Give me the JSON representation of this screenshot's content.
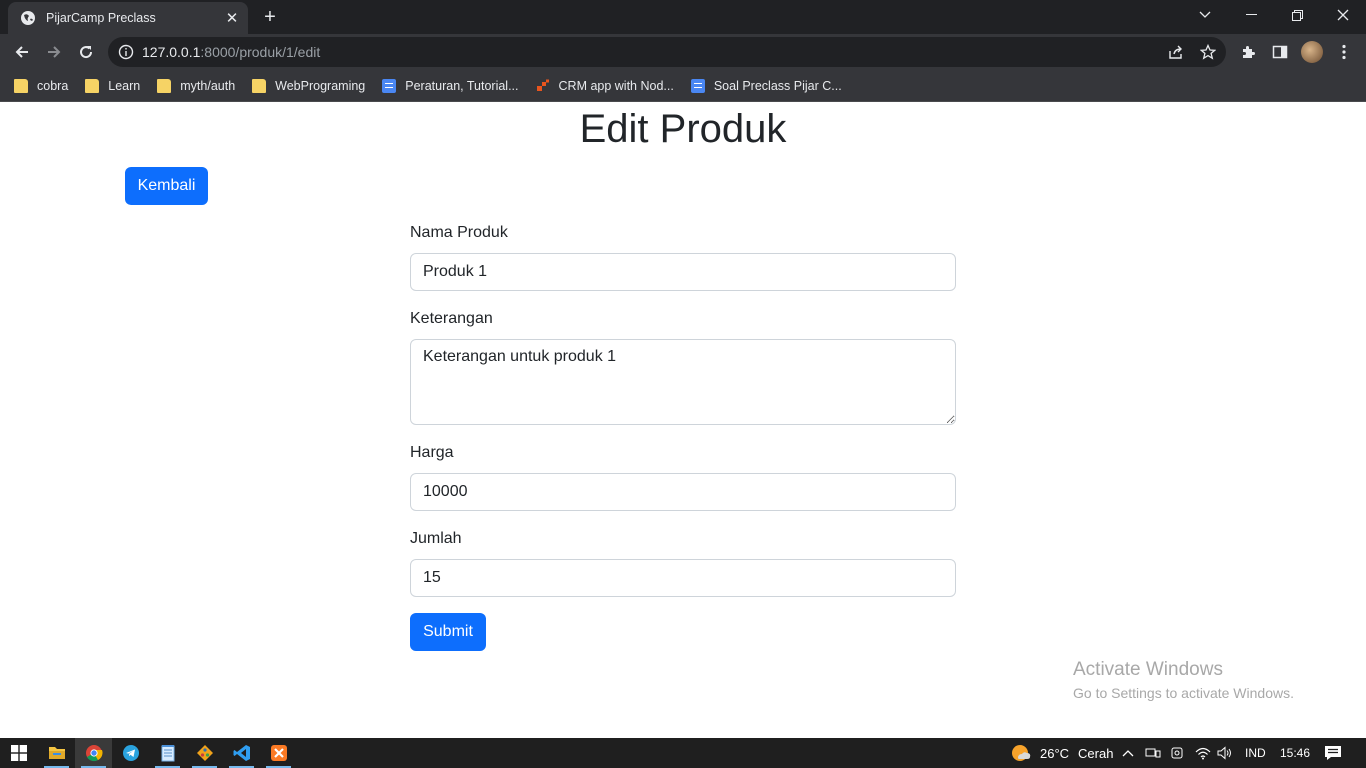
{
  "browser": {
    "tab_title": "PijarCamp Preclass",
    "url_host": "127.0.0.1",
    "url_path": ":8000/produk/1/edit",
    "bookmarks": [
      {
        "label": "cobra",
        "type": "folder"
      },
      {
        "label": "Learn",
        "type": "folder"
      },
      {
        "label": "myth/auth",
        "type": "folder"
      },
      {
        "label": "WebPrograming",
        "type": "folder"
      },
      {
        "label": "Peraturan, Tutorial...",
        "type": "doc"
      },
      {
        "label": "CRM app with Nod...",
        "type": "crm"
      },
      {
        "label": "Soal Preclass Pijar C...",
        "type": "doc"
      }
    ]
  },
  "page": {
    "title": "Edit Produk",
    "back_label": "Kembali",
    "form": {
      "name_label": "Nama Produk",
      "name_value": "Produk 1",
      "desc_label": "Keterangan",
      "desc_value": "Keterangan untuk produk 1",
      "price_label": "Harga",
      "price_value": "10000",
      "qty_label": "Jumlah",
      "qty_value": "15",
      "submit_label": "Submit"
    }
  },
  "watermark": {
    "line1": "Activate Windows",
    "line2": "Go to Settings to activate Windows."
  },
  "taskbar": {
    "weather_temp": "26°C",
    "weather_text": "Cerah",
    "language": "IND",
    "time": "15:46"
  },
  "colors": {
    "primary": "#0d6efd",
    "chrome_dark": "#202124",
    "chrome_mid": "#35363a"
  }
}
